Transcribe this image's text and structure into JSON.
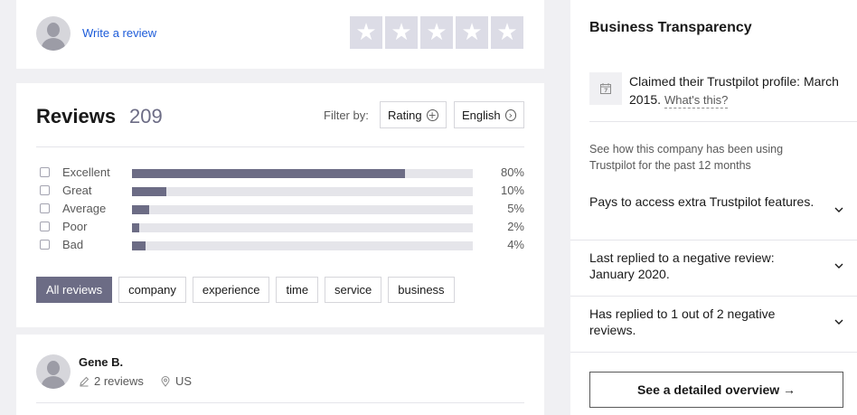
{
  "write_review": {
    "link_label": "Write a review",
    "star_glyph": "★",
    "star_count": 5,
    "star_color": "#dcdce6"
  },
  "reviews": {
    "title": "Reviews",
    "count": "209",
    "filter_label": "Filter by:",
    "filter_rating": "Rating",
    "filter_language": "English",
    "breakdown": [
      {
        "label": "Excellent",
        "percent": 80,
        "percent_text": "80%"
      },
      {
        "label": "Great",
        "percent": 10,
        "percent_text": "10%"
      },
      {
        "label": "Average",
        "percent": 5,
        "percent_text": "5%"
      },
      {
        "label": "Poor",
        "percent": 2,
        "percent_text": "2%"
      },
      {
        "label": "Bad",
        "percent": 4,
        "percent_text": "4%"
      }
    ],
    "tags": [
      "All reviews",
      "company",
      "experience",
      "time",
      "service",
      "business"
    ],
    "active_tag": "All reviews",
    "bar_color": "#6c6c85"
  },
  "review": {
    "reviewer_name": "Gene B.",
    "review_count": "2 reviews",
    "country": "US"
  },
  "sidebar": {
    "title": "Business Transparency",
    "claimed_text": "Claimed their Trustpilot profile: March 2015.",
    "whats_this": "What's this?",
    "see_how": "See how this company has been using Trustpilot for the past 12 months",
    "accordion": [
      {
        "text": "Pays to access extra Trustpilot features."
      },
      {
        "text": "Last replied to a negative review: January 2020."
      },
      {
        "text": "Has replied to 1 out of 2 negative reviews."
      }
    ],
    "overview_button": "See a detailed overview →"
  },
  "colors": {
    "link": "#1c5bd9",
    "background": "#f0f0f3",
    "accent": "#6c6c85"
  }
}
